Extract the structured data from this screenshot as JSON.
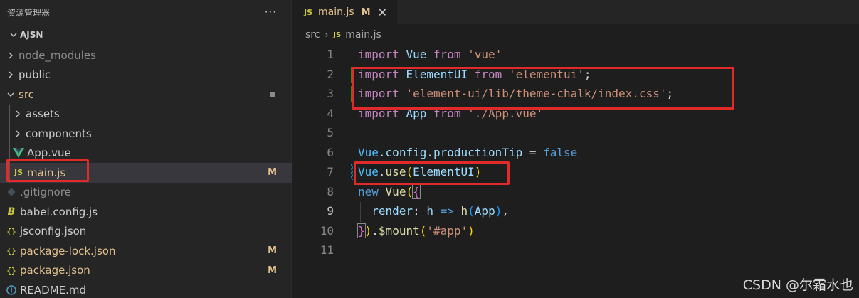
{
  "sidebar": {
    "title": "资源管理器",
    "more_label": "···",
    "root_label": "AJSN",
    "items": [
      {
        "label": "node_modules",
        "icon": "chevron-right-icon",
        "kind": "folder",
        "dim": true
      },
      {
        "label": "public",
        "icon": "chevron-right-icon",
        "kind": "folder"
      },
      {
        "label": "src",
        "icon": "chevron-down-icon",
        "kind": "folder-open",
        "modified_dot": true
      },
      {
        "label": "assets",
        "icon": "chevron-right-icon",
        "kind": "folder",
        "nested": true
      },
      {
        "label": "components",
        "icon": "chevron-right-icon",
        "kind": "folder",
        "nested": true
      },
      {
        "label": "App.vue",
        "icon": "vue-icon",
        "kind": "file",
        "nested": true
      },
      {
        "label": "main.js",
        "icon": "js-icon",
        "icon_text": "JS",
        "kind": "file",
        "nested": true,
        "status": "M",
        "selected": true
      },
      {
        "label": ".gitignore",
        "icon": "git-icon",
        "kind": "file",
        "dim": true
      },
      {
        "label": "babel.config.js",
        "icon": "babel-icon",
        "icon_text": "B",
        "kind": "file"
      },
      {
        "label": "jsconfig.json",
        "icon": "json-icon",
        "icon_text": "{}",
        "kind": "file"
      },
      {
        "label": "package-lock.json",
        "icon": "json-icon",
        "icon_text": "{}",
        "kind": "file",
        "status": "M"
      },
      {
        "label": "package.json",
        "icon": "json-icon",
        "icon_text": "{}",
        "kind": "file",
        "status": "M"
      },
      {
        "label": "README.md",
        "icon": "info-icon",
        "kind": "file"
      }
    ]
  },
  "editor": {
    "tab": {
      "icon_text": "JS",
      "name": "main.js",
      "status": "M",
      "close_label": "✕"
    },
    "breadcrumb": {
      "folder": "src",
      "separator": "›",
      "icon_text": "JS",
      "file": "main.js"
    },
    "lines": [
      "1",
      "2",
      "3",
      "4",
      "5",
      "6",
      "7",
      "8",
      "9",
      "10",
      "11"
    ]
  },
  "watermark": "CSDN @尔霜水也",
  "colors": {
    "highlight_box": "#e12a2a",
    "modified": "#e2c08d",
    "added_gutter": "#587c0c",
    "modified_gutter": "#1b81a8"
  }
}
